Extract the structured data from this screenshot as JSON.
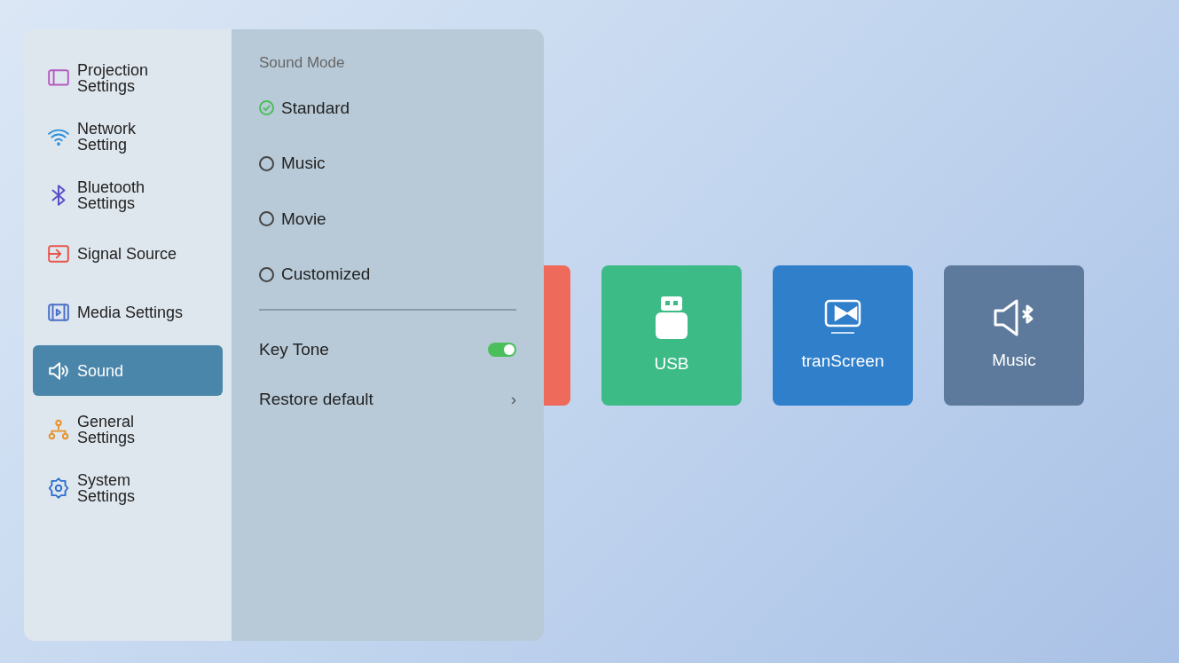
{
  "settings_menu": {
    "items": [
      {
        "label": "Projection Settings",
        "kind": "projection",
        "selected": false
      },
      {
        "label": "Network Setting",
        "kind": "network",
        "selected": false
      },
      {
        "label": "Bluetooth Settings",
        "kind": "bluetooth",
        "selected": false
      },
      {
        "label": "Signal Source",
        "kind": "source",
        "selected": false
      },
      {
        "label": "Media Settings",
        "kind": "media",
        "selected": false
      },
      {
        "label": "Sound",
        "kind": "sound",
        "selected": true
      },
      {
        "label": "General Settings",
        "kind": "general",
        "selected": false
      },
      {
        "label": "System Settings",
        "kind": "system",
        "selected": false
      }
    ]
  },
  "sound_panel": {
    "section_title": "Sound Mode",
    "modes": [
      {
        "label": "Standard",
        "selected": true
      },
      {
        "label": "Music",
        "selected": false
      },
      {
        "label": "Movie",
        "selected": false
      },
      {
        "label": "Customized",
        "selected": false
      }
    ],
    "key_tone": {
      "label": "Key Tone",
      "on": true
    },
    "restore": {
      "label": "Restore default",
      "chevron": "›"
    }
  },
  "home_tiles": [
    {
      "kind": "partial",
      "color": "#ee6a5a"
    },
    {
      "kind": "usb",
      "label": "USB",
      "color": "#3dbb86"
    },
    {
      "kind": "transcreen",
      "label": "tranScreen",
      "color": "#2f7fcb"
    },
    {
      "kind": "music",
      "label": "Music",
      "color": "#5d7a9c"
    }
  ]
}
